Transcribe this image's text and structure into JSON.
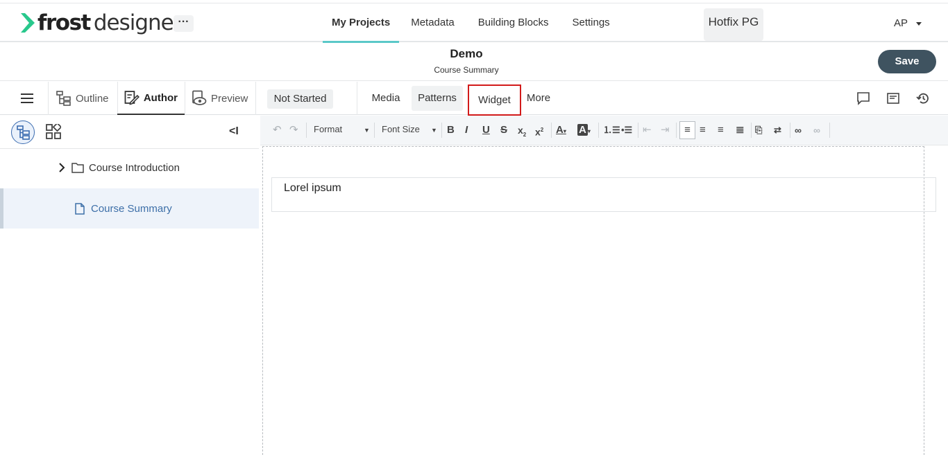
{
  "brand": {
    "name_bold": "frost",
    "name_light": "designer",
    "accent": "#28c88c"
  },
  "header": {
    "more_label": "···",
    "nav": [
      {
        "label": "My Projects",
        "active": true
      },
      {
        "label": "Metadata"
      },
      {
        "label": "Building Blocks"
      },
      {
        "label": "Settings"
      }
    ],
    "workspace": "Hotfix PG",
    "user": "AP"
  },
  "page": {
    "title": "Demo",
    "subtitle": "Course Summary",
    "save_label": "Save"
  },
  "modes": {
    "outline": "Outline",
    "author": "Author",
    "preview": "Preview"
  },
  "status": "Not Started",
  "tool_tabs": {
    "media": "Media",
    "patterns": "Patterns",
    "widget": "Widget",
    "more": "More"
  },
  "sidebar": {
    "collapse_label": "<I",
    "items": [
      {
        "label": "Course Introduction",
        "type": "folder"
      },
      {
        "label": "Course Summary",
        "type": "page",
        "active": true
      }
    ]
  },
  "toolbar": {
    "format_label": "Format",
    "font_size_label": "Font Size"
  },
  "editor": {
    "content": "Lorel ipsum"
  },
  "colors": {
    "save_bg": "#3f5360",
    "nav_underline": "#5ac8c8",
    "highlight_border": "#d21a1a",
    "active_link": "#3d6fa8"
  }
}
